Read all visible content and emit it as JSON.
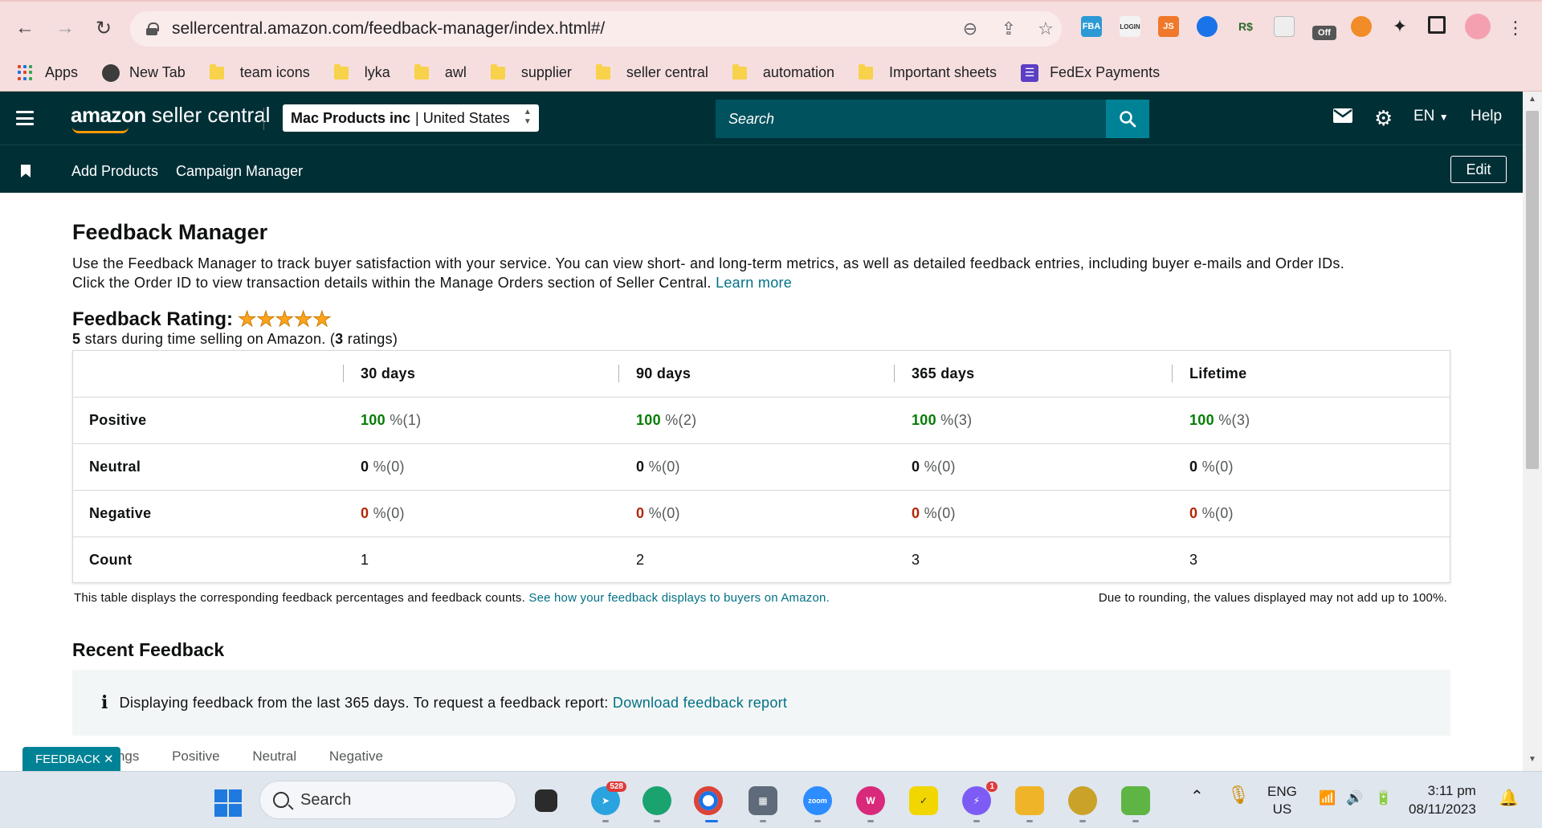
{
  "browser": {
    "url": "sellercentral.amazon.com/feedback-manager/index.html#/",
    "extensions": [
      "FBA",
      "LOGIN",
      "JS",
      "Off"
    ],
    "bookmarks": [
      {
        "label": "Apps",
        "icon": "apps-grid-icon"
      },
      {
        "label": "New Tab",
        "icon": "globe-icon"
      },
      {
        "label": "team icons",
        "icon": "folder-icon"
      },
      {
        "label": "lyka",
        "icon": "folder-icon"
      },
      {
        "label": "awl",
        "icon": "folder-icon"
      },
      {
        "label": "supplier",
        "icon": "folder-icon"
      },
      {
        "label": "seller central",
        "icon": "folder-icon"
      },
      {
        "label": "automation",
        "icon": "folder-icon"
      },
      {
        "label": "Important sheets",
        "icon": "folder-icon"
      },
      {
        "label": "FedEx Payments",
        "icon": "list-icon"
      }
    ]
  },
  "header": {
    "logo_bold": "amazon",
    "logo_rest": " seller central",
    "store_name": "Mac Products inc",
    "store_region": "United States",
    "search_placeholder": "Search",
    "language": "EN",
    "help": "Help"
  },
  "subnav": {
    "items": [
      "Add Products",
      "Campaign Manager"
    ],
    "edit": "Edit"
  },
  "page": {
    "title": "Feedback Manager",
    "intro_line1": "Use the Feedback Manager to track buyer satisfaction with your service. You can view short- and long-term metrics, as well as detailed feedback entries, including buyer e-mails and Order IDs.",
    "intro_line2": "Click the Order ID to view transaction details within the Manage Orders section of Seller Central.",
    "learn_more": "Learn more",
    "rating_title": "Feedback Rating:",
    "rating_stars": 5,
    "rating_sub_stars": "5",
    "rating_sub_text": " stars during time selling on Amazon. (",
    "rating_sub_count": "3",
    "rating_sub_end": " ratings)"
  },
  "table": {
    "columns": [
      "30 days",
      "90 days",
      "365 days",
      "Lifetime"
    ],
    "rows": [
      {
        "label": "Positive",
        "kind": "green",
        "values": [
          [
            "100",
            " %(1)"
          ],
          [
            "100",
            " %(2)"
          ],
          [
            "100",
            " %(3)"
          ],
          [
            "100",
            " %(3)"
          ]
        ]
      },
      {
        "label": "Neutral",
        "kind": "grey",
        "values": [
          [
            "0",
            " %(0)"
          ],
          [
            "0",
            " %(0)"
          ],
          [
            "0",
            " %(0)"
          ],
          [
            "0",
            " %(0)"
          ]
        ]
      },
      {
        "label": "Negative",
        "kind": "red",
        "values": [
          [
            "0",
            " %(0)"
          ],
          [
            "0",
            " %(0)"
          ],
          [
            "0",
            " %(0)"
          ],
          [
            "0",
            " %(0)"
          ]
        ]
      },
      {
        "label": "Count",
        "kind": "plain",
        "values": [
          [
            "1",
            ""
          ],
          [
            "2",
            ""
          ],
          [
            "3",
            ""
          ],
          [
            "3",
            ""
          ]
        ]
      }
    ],
    "note_text": "This table displays the corresponding feedback percentages and feedback counts.",
    "note_link": "See how your feedback displays to buyers on Amazon.",
    "note_right": "Due to rounding, the values displayed may not add up to 100%."
  },
  "recent": {
    "title": "Recent Feedback",
    "info_text": "Displaying feedback from the last 365 days. To request a feedback report:",
    "info_link": "Download feedback report",
    "tabs_peek": [
      "...ings",
      "Positive",
      "Neutral",
      "Negative"
    ]
  },
  "feedback_tab": "FEEDBACK ✕",
  "taskbar": {
    "search": "Search",
    "telegram_badge": "528",
    "messenger_badge": "1",
    "zoom_label": "zoom",
    "lang1": "ENG",
    "lang2": "US",
    "time": "3:11 pm",
    "date": "08/11/2023"
  }
}
